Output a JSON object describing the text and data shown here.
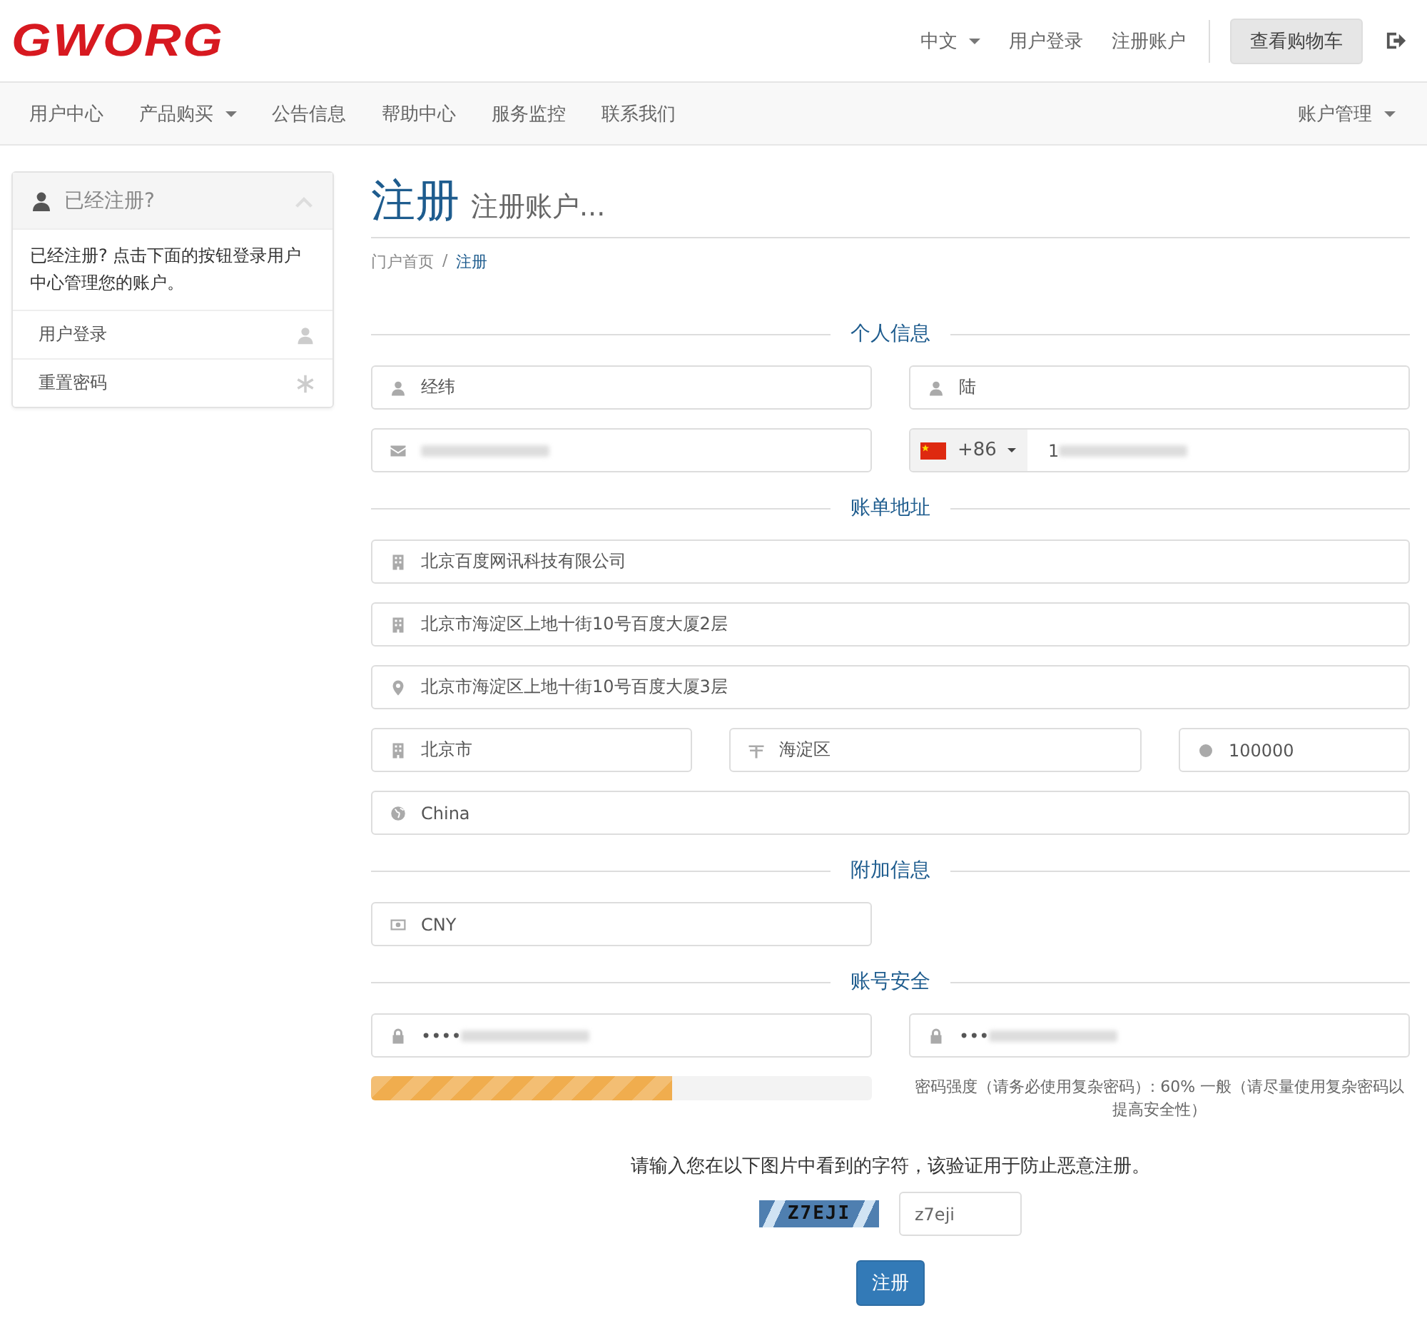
{
  "logo": "GWORG",
  "top_links": [
    {
      "label": "中文",
      "kind": "dropdown"
    },
    {
      "label": "用户登录",
      "kind": "link"
    },
    {
      "label": "注册账户",
      "kind": "link"
    }
  ],
  "cart_button": "查看购物车",
  "nav": {
    "items": [
      {
        "label": "用户中心",
        "dropdown": false
      },
      {
        "label": "产品购买",
        "dropdown": true
      },
      {
        "label": "公告信息",
        "dropdown": false
      },
      {
        "label": "帮助中心",
        "dropdown": false
      },
      {
        "label": "服务监控",
        "dropdown": false
      },
      {
        "label": "联系我们",
        "dropdown": false
      }
    ],
    "account_menu": "账户管理"
  },
  "sidebar": {
    "title": "已经注册?",
    "expanded": true,
    "text": "已经注册? 点击下面的按钮登录用户中心管理您的账户。",
    "items": [
      {
        "label": "用户登录",
        "kind": "user"
      },
      {
        "label": "重置密码",
        "kind": "asterisk"
      }
    ]
  },
  "page": {
    "title": "注册",
    "subtitle": "注册账户...",
    "breadcrumb_separator": "/",
    "breadcrumb": [
      {
        "label": "门户首页",
        "selected": false
      },
      {
        "label": "注册",
        "selected": true
      }
    ]
  },
  "sections": [
    {
      "heading": "个人信息",
      "rows": [
        {
          "kind": "half",
          "fields": [
            {
              "kind": "user",
              "value": "经纬"
            },
            {
              "kind": "user",
              "value": "陆"
            }
          ]
        },
        {
          "kind": "half",
          "fields": [
            {
              "kind": "envelope",
              "blurred": true
            },
            {
              "kind": "phone",
              "country_code": "+86",
              "value": "1",
              "blurred": true
            }
          ]
        }
      ]
    },
    {
      "heading": "账单地址",
      "rows": [
        {
          "kind": "full",
          "fields": [
            {
              "kind": "building",
              "value": "北京百度网讯科技有限公司"
            }
          ]
        },
        {
          "kind": "full",
          "fields": [
            {
              "kind": "building",
              "value": "北京市海淀区上地十街10号百度大厦2层"
            }
          ]
        },
        {
          "kind": "full",
          "fields": [
            {
              "kind": "marker",
              "value": "北京市海淀区上地十街10号百度大厦3层"
            }
          ]
        },
        {
          "kind": "thirds",
          "fields": [
            {
              "kind": "building",
              "value": "北京市"
            },
            {
              "kind": "road",
              "value": "海淀区"
            },
            {
              "kind": "dot",
              "value": "100000"
            }
          ]
        },
        {
          "kind": "full",
          "fields": [
            {
              "kind": "globe",
              "value": "China"
            }
          ]
        }
      ]
    },
    {
      "heading": "附加信息",
      "rows": [
        {
          "kind": "half",
          "fields": [
            {
              "kind": "money",
              "value": "CNY"
            }
          ]
        }
      ]
    },
    {
      "heading": "账号安全",
      "rows": [
        {
          "kind": "half",
          "fields": [
            {
              "kind": "lock",
              "value": "••••",
              "blurred": true
            },
            {
              "kind": "lock",
              "value": "•••",
              "blurred": true
            }
          ]
        }
      ]
    }
  ],
  "strength": {
    "level": 0.6,
    "text": "密码强度（请务必使用复杂密码）: 60% 一般（请尽量使用复杂密码以提高安全性）"
  },
  "captcha": {
    "prompt": "请输入您在以下图片中看到的字符，该验证用于防止恶意注册。",
    "image_text": "Z7EJI",
    "value": "z7eji"
  },
  "submit": "注册"
}
